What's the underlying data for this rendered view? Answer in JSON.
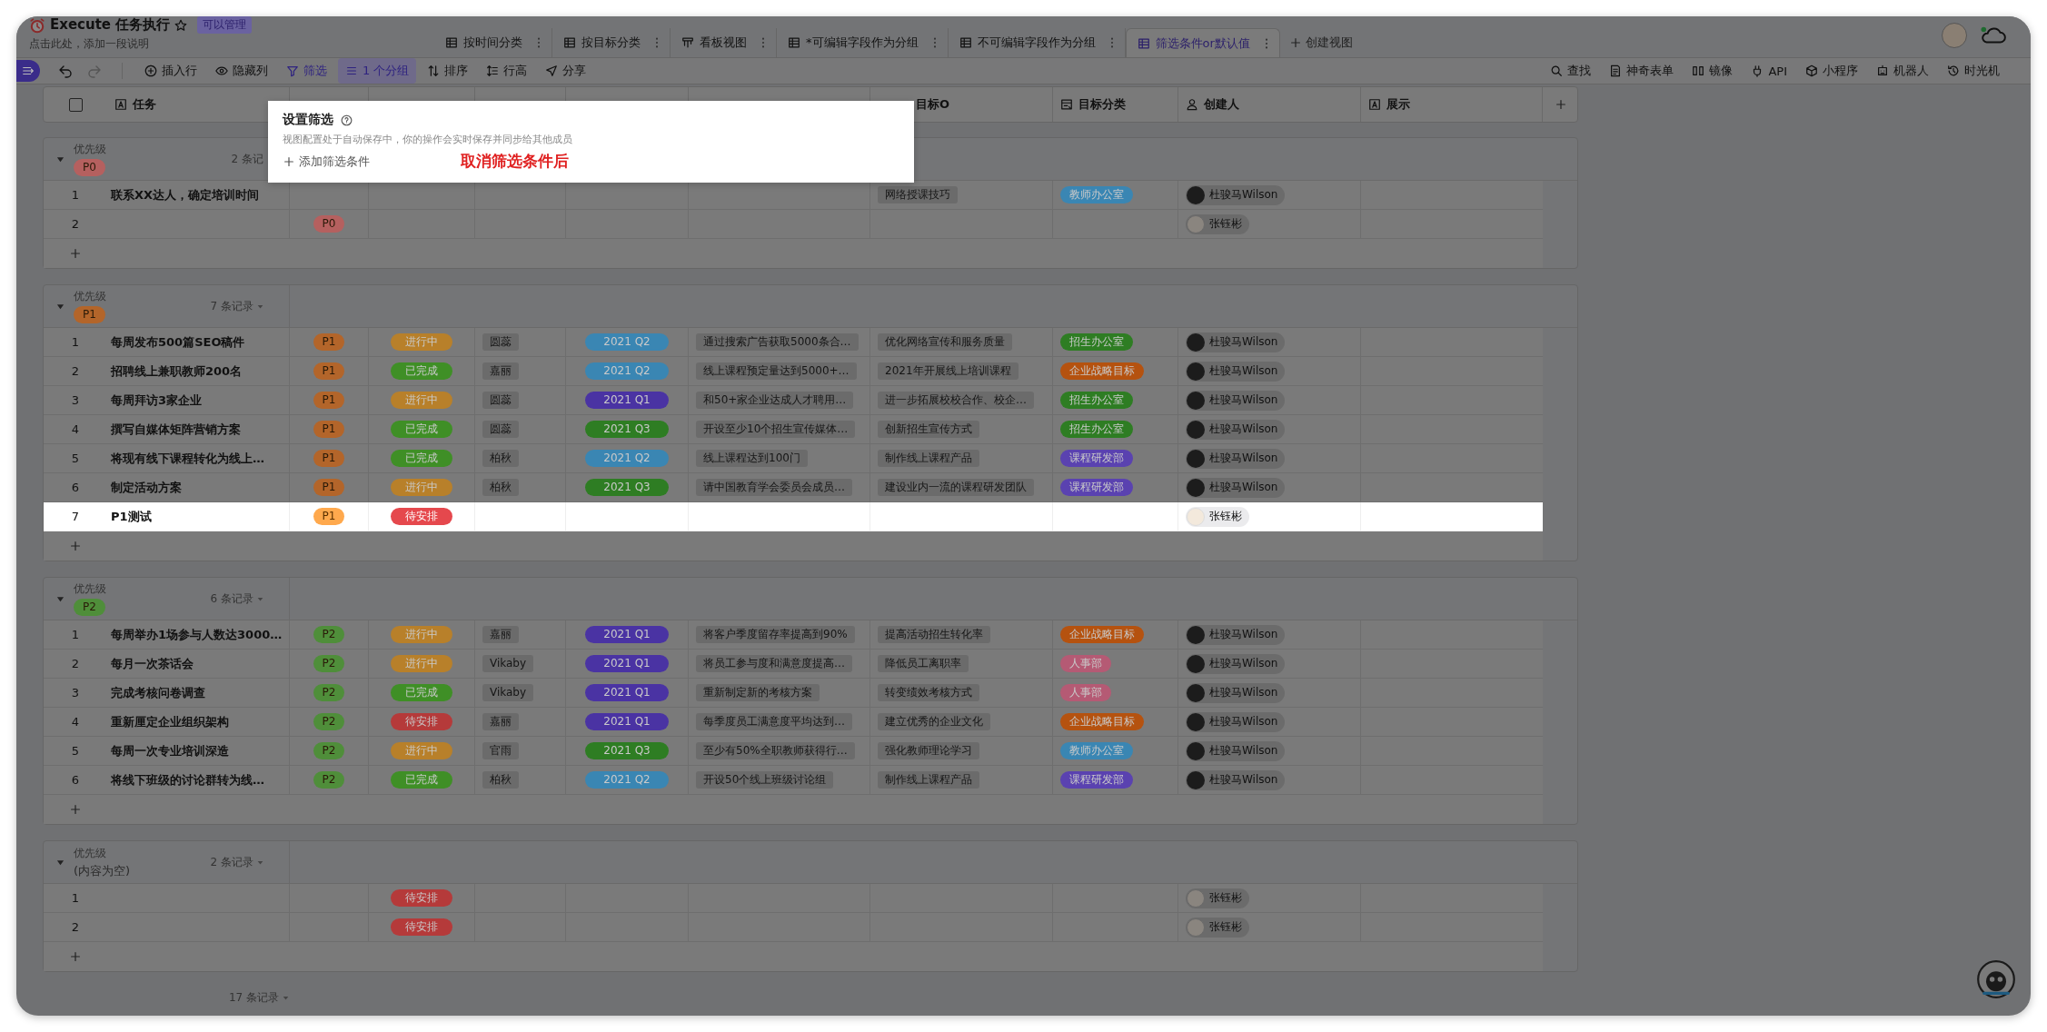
{
  "header": {
    "title": "Execute 任务执行",
    "permission": "可以管理",
    "description": "点击此处，添加一段说明"
  },
  "view_tabs": [
    {
      "label": "按时间分类",
      "kind": "grid",
      "selected": false
    },
    {
      "label": "按目标分类",
      "kind": "grid",
      "selected": false
    },
    {
      "label": "看板视图",
      "kind": "kanban",
      "selected": false
    },
    {
      "label": "*可编辑字段作为分组",
      "kind": "grid",
      "selected": false
    },
    {
      "label": "不可编辑字段作为分组",
      "kind": "grid",
      "selected": false
    },
    {
      "label": "筛选条件or默认值",
      "kind": "grid",
      "selected": true
    }
  ],
  "create_view": "创建视图",
  "toolbar_left": [
    {
      "label": "插入行",
      "kind": "insert",
      "active": false,
      "boxed": false
    },
    {
      "label": "隐藏列",
      "kind": "hide",
      "active": false,
      "boxed": false
    },
    {
      "label": "筛选",
      "kind": "filter",
      "active": true,
      "boxed": false
    },
    {
      "label": "1 个分组",
      "kind": "group",
      "active": true,
      "boxed": true
    },
    {
      "label": "排序",
      "kind": "sort",
      "active": false,
      "boxed": false
    },
    {
      "label": "行高",
      "kind": "height",
      "active": false,
      "boxed": false
    },
    {
      "label": "分享",
      "kind": "share",
      "active": false,
      "boxed": false
    }
  ],
  "toolbar_right": [
    {
      "label": "查找",
      "kind": "search"
    },
    {
      "label": "神奇表单",
      "kind": "form"
    },
    {
      "label": "镜像",
      "kind": "mirror"
    },
    {
      "label": "API",
      "kind": "api"
    },
    {
      "label": "小程序",
      "kind": "applet"
    },
    {
      "label": "机器人",
      "kind": "robot"
    },
    {
      "label": "时光机",
      "kind": "history"
    }
  ],
  "select_all_checked": false,
  "columns": [
    {
      "label": "任务",
      "kind": "text"
    },
    {
      "label": "目标O",
      "kind": "plain"
    },
    {
      "label": "目标分类",
      "kind": "category"
    },
    {
      "label": "创建人",
      "kind": "person"
    },
    {
      "label": "展示",
      "kind": "text"
    }
  ],
  "groups": [
    {
      "field": "优先级",
      "tag": {
        "text": "P0",
        "color": "#b5605f"
      },
      "count": "2 条记",
      "count_menu": false,
      "expanded": true,
      "rows": [
        {
          "index": "1",
          "task": "联系XX达人，确定培训时间",
          "objective": "网络授课技巧",
          "category": {
            "text": "教师办公室",
            "color": "#3a86b3"
          },
          "creator": {
            "name": "杜骏马Wilson",
            "kind": "dark"
          },
          "highlighted": false
        },
        {
          "index": "2",
          "priority": {
            "text": "P0",
            "color": "#b5605f"
          },
          "creator": {
            "name": "张钰彬",
            "kind": "light"
          },
          "highlighted": false
        }
      ]
    },
    {
      "field": "优先级",
      "tag": {
        "text": "P1",
        "color": "#b3652a"
      },
      "count": "7 条记录",
      "count_menu": true,
      "expanded": true,
      "rows": [
        {
          "index": "1",
          "task": "每周发布500篇SEO稿件",
          "priority": {
            "text": "P1",
            "color": "#b3652a"
          },
          "status": {
            "text": "进行中",
            "color": "#b8802a"
          },
          "owner": "圆蕊",
          "quarter": {
            "text": "2021 Q2",
            "color": "#3a86b3"
          },
          "kr": "通过搜索广告获取5000条合…",
          "objective": "优化网络宣传和服务质量",
          "category": {
            "text": "招生办公室",
            "color": "#2e7d23"
          },
          "creator": {
            "name": "杜骏马Wilson",
            "kind": "dark"
          },
          "highlighted": false
        },
        {
          "index": "2",
          "task": "招聘线上兼职教师200名",
          "priority": {
            "text": "P1",
            "color": "#b3652a"
          },
          "status": {
            "text": "已完成",
            "color": "#3f8f26"
          },
          "owner": "嘉丽",
          "quarter": {
            "text": "2021 Q2",
            "color": "#3a86b3"
          },
          "kr": "线上课程预定量达到5000+…",
          "objective": "2021年开展线上培训课程",
          "category": {
            "text": "企业战略目标",
            "color": "#b5520f"
          },
          "creator": {
            "name": "杜骏马Wilson",
            "kind": "dark"
          },
          "highlighted": false
        },
        {
          "index": "3",
          "task": "每周拜访3家企业",
          "priority": {
            "text": "P1",
            "color": "#b3652a"
          },
          "status": {
            "text": "进行中",
            "color": "#b8802a"
          },
          "owner": "圆蕊",
          "quarter": {
            "text": "2021 Q1",
            "color": "#4a33a3"
          },
          "kr": "和50+家企业达成人才聘用…",
          "objective": "进一步拓展校校合作、校企…",
          "category": {
            "text": "招生办公室",
            "color": "#2e7d23"
          },
          "creator": {
            "name": "杜骏马Wilson",
            "kind": "dark"
          },
          "highlighted": false
        },
        {
          "index": "4",
          "task": "撰写自媒体矩阵营销方案",
          "priority": {
            "text": "P1",
            "color": "#b3652a"
          },
          "status": {
            "text": "已完成",
            "color": "#3f8f26"
          },
          "owner": "圆蕊",
          "quarter": {
            "text": "2021 Q3",
            "color": "#2e7d23"
          },
          "kr": "开设至少10个招生宣传媒体…",
          "objective": "创新招生宣传方式",
          "category": {
            "text": "招生办公室",
            "color": "#2e7d23"
          },
          "creator": {
            "name": "杜骏马Wilson",
            "kind": "dark"
          },
          "highlighted": false
        },
        {
          "index": "5",
          "task": "将现有线下课程转化为线上…",
          "priority": {
            "text": "P1",
            "color": "#b3652a"
          },
          "status": {
            "text": "已完成",
            "color": "#3f8f26"
          },
          "owner": "柏秋",
          "quarter": {
            "text": "2021 Q2",
            "color": "#3a86b3"
          },
          "kr": "线上课程达到100门",
          "objective": "制作线上课程产品",
          "category": {
            "text": "课程研发部",
            "color": "#5a42b0"
          },
          "creator": {
            "name": "杜骏马Wilson",
            "kind": "dark"
          },
          "highlighted": false
        },
        {
          "index": "6",
          "task": "制定活动方案",
          "priority": {
            "text": "P1",
            "color": "#b3652a"
          },
          "status": {
            "text": "进行中",
            "color": "#b8802a"
          },
          "owner": "柏秋",
          "quarter": {
            "text": "2021 Q3",
            "color": "#2e7d23"
          },
          "kr": "请中国教育学会委员会成员…",
          "objective": "建设业内一流的课程研发团队",
          "category": {
            "text": "课程研发部",
            "color": "#5a42b0"
          },
          "creator": {
            "name": "杜骏马Wilson",
            "kind": "dark"
          },
          "highlighted": false
        },
        {
          "index": "7",
          "task": "P1测试",
          "priority": {
            "text": "P1",
            "color": "#ffa94d"
          },
          "status": {
            "text": "待安排",
            "color": "#e5484d"
          },
          "creator": {
            "name": "张钰彬",
            "kind": "light"
          },
          "highlighted": true
        }
      ]
    },
    {
      "field": "优先级",
      "tag": {
        "text": "P2",
        "color": "#4f8e3a"
      },
      "count": "6 条记录",
      "count_menu": true,
      "expanded": true,
      "rows": [
        {
          "index": "1",
          "task": "每周举办1场参与人数达3000…",
          "priority": {
            "text": "P2",
            "color": "#4f8e3a"
          },
          "status": {
            "text": "进行中",
            "color": "#b8802a"
          },
          "owner": "嘉丽",
          "quarter": {
            "text": "2021 Q1",
            "color": "#4a33a3"
          },
          "kr": "将客户季度留存率提高到90%",
          "objective": "提高活动招生转化率",
          "category": {
            "text": "企业战略目标",
            "color": "#b5520f"
          },
          "creator": {
            "name": "杜骏马Wilson",
            "kind": "dark"
          },
          "highlighted": false
        },
        {
          "index": "2",
          "task": "每月一次茶话会",
          "priority": {
            "text": "P2",
            "color": "#4f8e3a"
          },
          "status": {
            "text": "进行中",
            "color": "#b8802a"
          },
          "owner": "Vikaby",
          "quarter": {
            "text": "2021 Q1",
            "color": "#4a33a3"
          },
          "kr": "将员工参与度和满意度提高…",
          "objective": "降低员工离职率",
          "category": {
            "text": "人事部",
            "color": "#b55a74"
          },
          "creator": {
            "name": "杜骏马Wilson",
            "kind": "dark"
          },
          "highlighted": false
        },
        {
          "index": "3",
          "task": "完成考核问卷调查",
          "priority": {
            "text": "P2",
            "color": "#4f8e3a"
          },
          "status": {
            "text": "已完成",
            "color": "#3f8f26"
          },
          "owner": "Vikaby",
          "quarter": {
            "text": "2021 Q1",
            "color": "#4a33a3"
          },
          "kr": "重新制定新的考核方案",
          "objective": "转变绩效考核方式",
          "category": {
            "text": "人事部",
            "color": "#b55a74"
          },
          "creator": {
            "name": "杜骏马Wilson",
            "kind": "dark"
          },
          "highlighted": false
        },
        {
          "index": "4",
          "task": "重新厘定企业组织架构",
          "priority": {
            "text": "P2",
            "color": "#4f8e3a"
          },
          "status": {
            "text": "待安排",
            "color": "#b53a3a"
          },
          "owner": "嘉丽",
          "quarter": {
            "text": "2021 Q1",
            "color": "#4a33a3"
          },
          "kr": "每季度员工满意度平均达到…",
          "objective": "建立优秀的企业文化",
          "category": {
            "text": "企业战略目标",
            "color": "#b5520f"
          },
          "creator": {
            "name": "杜骏马Wilson",
            "kind": "dark"
          },
          "highlighted": false
        },
        {
          "index": "5",
          "task": "每周一次专业培训深造",
          "priority": {
            "text": "P2",
            "color": "#4f8e3a"
          },
          "status": {
            "text": "进行中",
            "color": "#b8802a"
          },
          "owner": "官雨",
          "quarter": {
            "text": "2021 Q3",
            "color": "#2e7d23"
          },
          "kr": "至少有50%全职教师获得行…",
          "objective": "强化教师理论学习",
          "category": {
            "text": "教师办公室",
            "color": "#3a86b3"
          },
          "creator": {
            "name": "杜骏马Wilson",
            "kind": "dark"
          },
          "highlighted": false
        },
        {
          "index": "6",
          "task": "将线下班级的讨论群转为线…",
          "priority": {
            "text": "P2",
            "color": "#4f8e3a"
          },
          "status": {
            "text": "已完成",
            "color": "#3f8f26"
          },
          "owner": "柏秋",
          "quarter": {
            "text": "2021 Q2",
            "color": "#3a86b3"
          },
          "kr": "开设50个线上班级讨论组",
          "objective": "制作线上课程产品",
          "category": {
            "text": "课程研发部",
            "color": "#5a42b0"
          },
          "creator": {
            "name": "杜骏马Wilson",
            "kind": "dark"
          },
          "highlighted": false
        }
      ]
    },
    {
      "field": "优先级",
      "empty_label": "(内容为空)",
      "count": "2 条记录",
      "count_menu": true,
      "expanded": true,
      "rows": [
        {
          "index": "1",
          "status": {
            "text": "待安排",
            "color": "#b53a3a"
          },
          "creator": {
            "name": "张钰彬",
            "kind": "light"
          },
          "highlighted": false
        },
        {
          "index": "2",
          "status": {
            "text": "待安排",
            "color": "#b53a3a"
          },
          "creator": {
            "name": "张钰彬",
            "kind": "light"
          },
          "highlighted": false
        }
      ]
    }
  ],
  "footer": {
    "count": "17 条记录"
  },
  "filter_popup": {
    "title": "设置筛选",
    "description": "视图配置处于自动保存中，你的操作会实时保存并同步给其他成员",
    "add_label": "添加筛选条件",
    "annotation": "取消筛选条件后"
  }
}
